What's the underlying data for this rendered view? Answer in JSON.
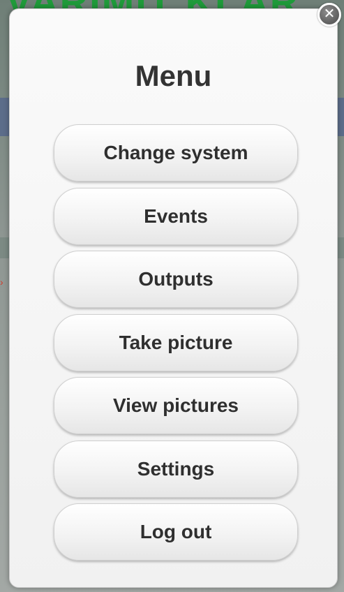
{
  "background": {
    "title_fragment": "VARIMIT KLAR"
  },
  "popup": {
    "close_glyph": "✕",
    "title": "Menu",
    "items": [
      {
        "label": "Change system"
      },
      {
        "label": "Events"
      },
      {
        "label": "Outputs"
      },
      {
        "label": "Take picture"
      },
      {
        "label": "View pictures"
      },
      {
        "label": "Settings"
      },
      {
        "label": "Log out"
      }
    ]
  },
  "colors": {
    "background_title": "#1f9a3a",
    "button_text": "#2f2f2f",
    "popup_bg": "#f5f5f5",
    "close_button": "#6a6a6a"
  }
}
